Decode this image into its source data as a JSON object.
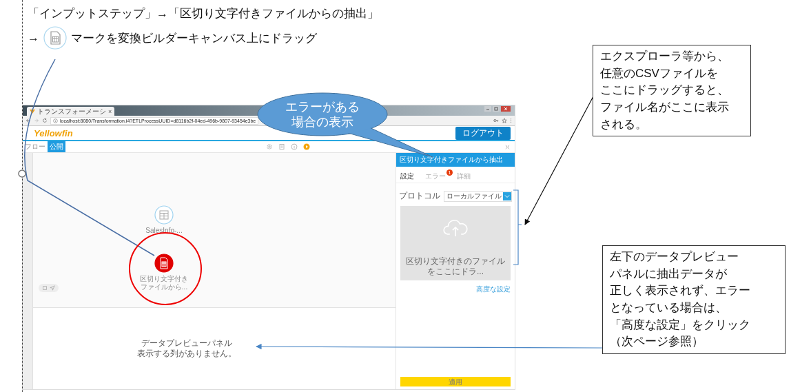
{
  "instruction": {
    "line_1": "「インプットステップ」→「区切り文字付きファイルからの抽出」",
    "arrow": "→",
    "line_2": "マークを変換ビルダーキャンバス上にドラッグ"
  },
  "callout": "エラーがある場合の表示",
  "notes": [
    {
      "lines": [
        "エクスプローラ等から、",
        "任意のCSVファイルを",
        "ここにドラッグすると、",
        "ファイル名がここに表示",
        "される。"
      ]
    },
    {
      "lines": [
        "左下のデータプレビュー",
        "パネルに抽出データが",
        "正しく表示されず、エラー",
        "となっている場合は、",
        "「高度な設定」をクリック",
        "（次ページ参照）"
      ]
    }
  ],
  "browser": {
    "tab_title": "トランスフォーメーシ",
    "tab_close": "×",
    "url": "localhost:8080/Transformation.i4?ETLProcessUUID=d8116b2f-04ed-496b-9807-93454e3be",
    "logo": "Yellowfin",
    "logout_button": "ログアウト"
  },
  "toolbar": {
    "tabs": [
      {
        "label": "フロー",
        "selected": false
      },
      {
        "label": "公開",
        "selected": true
      }
    ]
  },
  "canvas": {
    "nodes": [
      {
        "label": "SalesInfo-...",
        "kind": "table",
        "error": false
      },
      {
        "label": "区切り文字付きファイルから...",
        "kind": "file",
        "error": true
      }
    ]
  },
  "preview": {
    "title": "データプレビューパネル",
    "message": "表示する列がありません。"
  },
  "panel": {
    "title": "区切り文字付きファイルから抽出",
    "tabs": [
      {
        "label": "設定",
        "selected": true
      },
      {
        "label": "エラー",
        "selected": false,
        "badge": "1"
      },
      {
        "label": "詳細",
        "selected": false
      }
    ],
    "protocol_label": "プロトコル",
    "protocol_value": "ローカルファイル",
    "dropzone_text": "区切り文字付きのファイルをここにドラ...",
    "advanced_link": "高度な設定",
    "apply_button": "適用"
  }
}
